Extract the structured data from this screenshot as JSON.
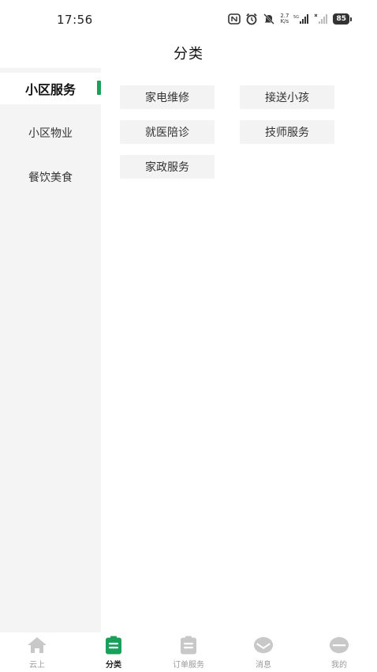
{
  "status_bar": {
    "time": "17:56",
    "speed_top": "2.7",
    "speed_bottom": "K/s",
    "battery": "85",
    "icons": [
      "nfc-icon",
      "alarm-icon",
      "mute-icon",
      "signal-icon",
      "signal-no-service-icon",
      "battery-icon"
    ]
  },
  "header": {
    "title": "分类"
  },
  "sidebar": {
    "items": [
      {
        "label": "小区服务",
        "active": true
      },
      {
        "label": "小区物业",
        "active": false
      },
      {
        "label": "餐饮美食",
        "active": false
      }
    ]
  },
  "content": {
    "chips": [
      {
        "label": "家电维修"
      },
      {
        "label": "接送小孩"
      },
      {
        "label": "就医陪诊"
      },
      {
        "label": "技师服务"
      },
      {
        "label": "家政服务"
      }
    ]
  },
  "bottom_nav": {
    "items": [
      {
        "label": "云上",
        "icon": "home-icon",
        "active": false
      },
      {
        "label": "分类",
        "icon": "category-icon",
        "active": true
      },
      {
        "label": "订单服务",
        "icon": "orders-icon",
        "active": false
      },
      {
        "label": "消息",
        "icon": "message-icon",
        "active": false
      },
      {
        "label": "我的",
        "icon": "profile-icon",
        "active": false
      }
    ]
  },
  "colors": {
    "accent": "#19a05a",
    "sidebar_bg": "#f4f4f4",
    "chip_bg": "#f3f3f3",
    "inactive_icon": "#c8c8c8"
  }
}
